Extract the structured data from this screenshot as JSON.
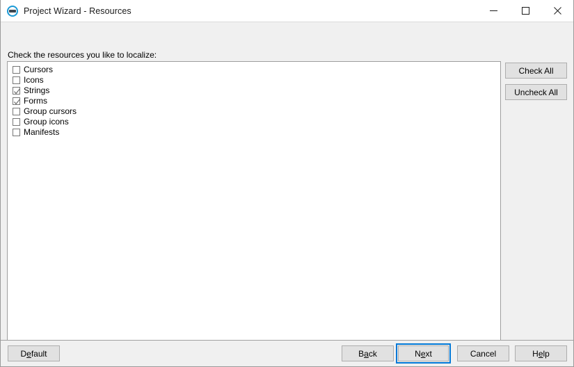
{
  "window": {
    "title": "Project Wizard - Resources",
    "icon": "project-wizard-icon",
    "controls": {
      "minimize": "minimize-icon",
      "maximize": "maximize-icon",
      "close": "close-icon"
    }
  },
  "main": {
    "prompt": "Check the resources you like to localize:",
    "resources": [
      {
        "label": "Cursors",
        "checked": false
      },
      {
        "label": "Icons",
        "checked": false
      },
      {
        "label": "Strings",
        "checked": true
      },
      {
        "label": "Forms",
        "checked": true
      },
      {
        "label": "Group cursors",
        "checked": false
      },
      {
        "label": "Group icons",
        "checked": false
      },
      {
        "label": "Manifests",
        "checked": false
      }
    ]
  },
  "side_buttons": {
    "check_all": "Check All",
    "uncheck_all": "Uncheck All"
  },
  "footer": {
    "default": {
      "pre": "D",
      "key": "e",
      "post": "fault"
    },
    "back": {
      "pre": "B",
      "key": "a",
      "post": "ck"
    },
    "next": {
      "pre": "N",
      "key": "e",
      "post": "xt"
    },
    "cancel": {
      "pre": "Cancel",
      "key": "",
      "post": ""
    },
    "help": {
      "pre": "H",
      "key": "e",
      "post": "lp"
    }
  },
  "colors": {
    "accent": "#0078d7",
    "icon_blue": "#1b9ad6",
    "window_bg": "#f0f0f0",
    "button_face": "#e1e1e1",
    "button_border": "#adadad",
    "list_bg": "#ffffff",
    "list_border": "#9e9e9e",
    "checkmark": "#707070"
  }
}
